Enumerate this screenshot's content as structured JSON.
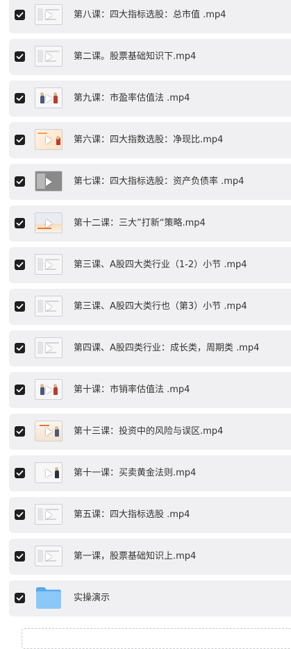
{
  "files": [
    {
      "name": "第八课：四大指标选股：总市值 .mp4",
      "checked": true,
      "type": "video",
      "thumb": "slide"
    },
    {
      "name": "第二课。股票基础知识下.mp4",
      "checked": true,
      "type": "video",
      "thumb": "slide"
    },
    {
      "name": "第九课：市盈率估值法 .mp4",
      "checked": true,
      "type": "video",
      "thumb": "people"
    },
    {
      "name": "第六课：四大指数选股：净现比.mp4",
      "checked": true,
      "type": "video",
      "thumb": "orange"
    },
    {
      "name": "第七课：四大指标选股：资产负债率 .mp4",
      "checked": true,
      "type": "video",
      "thumb": "grey"
    },
    {
      "name": "第十二课：三大”打新“策略.mp4",
      "checked": true,
      "type": "video",
      "thumb": "photo"
    },
    {
      "name": "第三课、A股四大类行业（1-2）小节 .mp4",
      "checked": true,
      "type": "video",
      "thumb": "slide"
    },
    {
      "name": "第三课、A股四大类行也（第3）小节 .mp4",
      "checked": true,
      "type": "video",
      "thumb": "slide"
    },
    {
      "name": "第四课、A股四类行业：成长类，周期类 .mp4",
      "checked": true,
      "type": "video",
      "thumb": "slide"
    },
    {
      "name": "第十课：市销率估值法 .mp4",
      "checked": true,
      "type": "video",
      "thumb": "people"
    },
    {
      "name": "第十三课：投资中的风险与误区.mp4",
      "checked": true,
      "type": "video",
      "thumb": "warm"
    },
    {
      "name": "第十一课：买卖黄金法则.mp4",
      "checked": true,
      "type": "video",
      "thumb": "person"
    },
    {
      "name": "第五课：四大指标选股 .mp4",
      "checked": true,
      "type": "video",
      "thumb": "slide"
    },
    {
      "name": "第一课，股票基础知识上.mp4",
      "checked": true,
      "type": "video",
      "thumb": "slide"
    },
    {
      "name": "实操演示",
      "checked": true,
      "type": "folder",
      "thumb": "folder"
    }
  ],
  "icons": {
    "checkbox": "checkbox-checked-icon",
    "video": "video-thumbnail-icon",
    "play": "play-icon",
    "folder": "folder-icon"
  },
  "colors": {
    "row_background": "#f0f0f2",
    "checkbox": "#1f1f1f",
    "text": "#333333",
    "folder": "#6fb7f2"
  }
}
